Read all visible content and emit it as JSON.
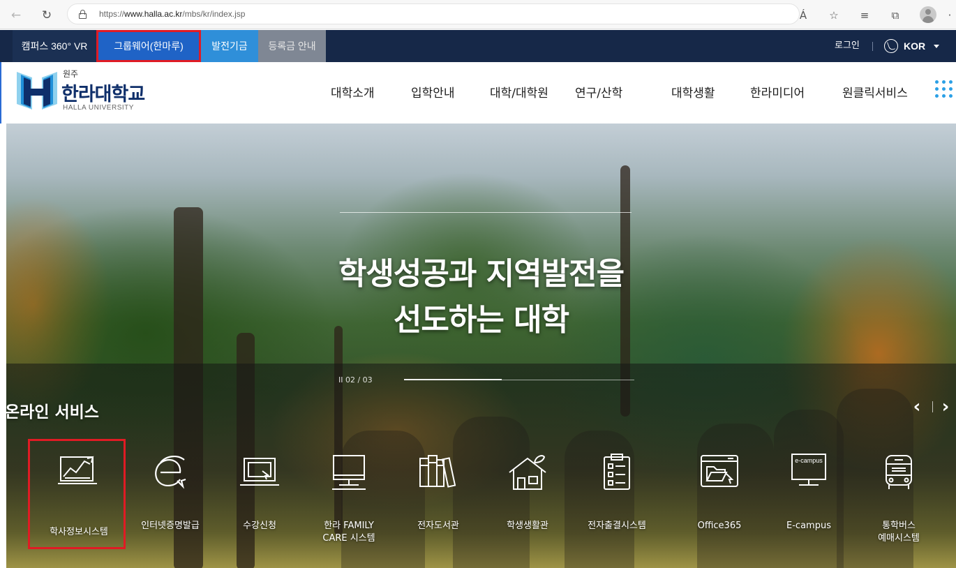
{
  "browser": {
    "url_prefix": "https://",
    "url_domain": "www.halla.ac.kr",
    "url_path": "/mbs/kr/index.jsp",
    "read_aloud": "Á",
    "icons": [
      "back-icon",
      "reload-icon",
      "lock-icon",
      "read-aloud-icon",
      "favorite-icon",
      "favorites-list-icon",
      "collections-icon",
      "profile-icon"
    ]
  },
  "util_bar": {
    "links": [
      "캠퍼스 360° VR",
      "그룹웨어(한마루)",
      "발전기금",
      "등록금 안내"
    ],
    "login": "로그인",
    "language": "KOR"
  },
  "header": {
    "logo_sub": "원주",
    "logo_main": "한라대학교",
    "logo_en": "HALLA UNIVERSITY",
    "menu": [
      "대학소개",
      "입학안내",
      "대학/대학원",
      "연구/산학",
      "대학생활",
      "한라미디어",
      "원클릭서비스"
    ]
  },
  "hero": {
    "title_line1": "학생성공과 지역발전을",
    "title_line2": "선도하는 대학",
    "pager": "II   02 / 03"
  },
  "services": {
    "heading": "온라인 서비스",
    "items": [
      {
        "label": "학사정보시스템",
        "icon": "academic-chart-icon"
      },
      {
        "label": "인터넷증명발급",
        "icon": "internet-certificate-icon"
      },
      {
        "label": "수강신청",
        "icon": "course-registration-icon"
      },
      {
        "label": "한라 FAMILY",
        "label2": "CARE 시스템",
        "icon": "family-care-monitor-icon"
      },
      {
        "label": "전자도서관",
        "icon": "library-books-icon"
      },
      {
        "label": "학생생활관",
        "icon": "dormitory-house-icon"
      },
      {
        "label": "전자출결시스템",
        "icon": "attendance-clipboard-icon"
      },
      {
        "label": "Office365",
        "icon": "office365-folder-icon"
      },
      {
        "label": "E-campus",
        "icon": "ecampus-monitor-icon",
        "screen_text": "e-campus"
      },
      {
        "label": "통학버스",
        "label2": "예매시스템",
        "icon": "bus-icon"
      }
    ]
  },
  "colors": {
    "util_bar": "#162848",
    "groupware_bg": "#1f63c6",
    "fund_bg": "#2f8fd9",
    "tuition_bg": "#7f8794",
    "highlight_border": "#e01b24",
    "brand_navy": "#0f2f6a",
    "brand_cyan": "#2ba0e6"
  }
}
